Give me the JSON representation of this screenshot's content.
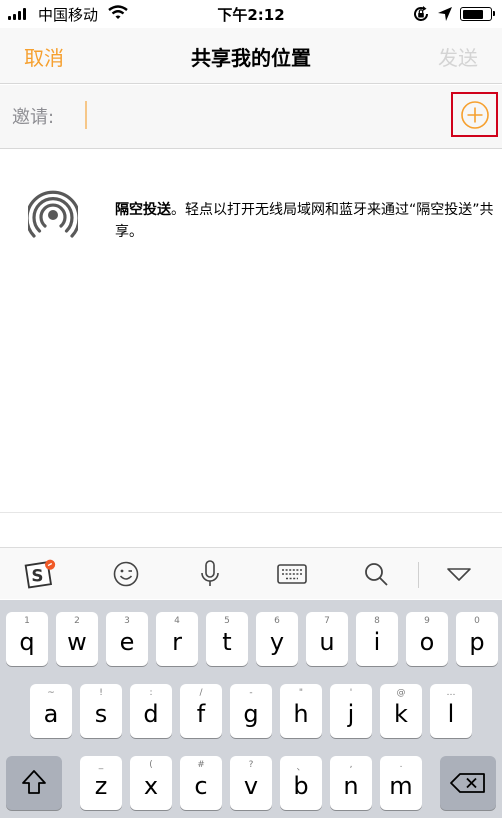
{
  "status_bar": {
    "carrier": "中国移动",
    "time": "下午2:12",
    "battery_level": 0.75
  },
  "nav": {
    "cancel_label": "取消",
    "title": "共享我的位置",
    "send_label": "发送"
  },
  "invite": {
    "label": "邀请:",
    "value": ""
  },
  "airdrop": {
    "title": "隔空投送",
    "description": "。轻点以打开无线局域网和蓝牙来通过“隔空投送”共享。"
  },
  "keyboard": {
    "row1": [
      {
        "main": "q",
        "sub": "1"
      },
      {
        "main": "w",
        "sub": "2"
      },
      {
        "main": "e",
        "sub": "3"
      },
      {
        "main": "r",
        "sub": "4"
      },
      {
        "main": "t",
        "sub": "5"
      },
      {
        "main": "y",
        "sub": "6"
      },
      {
        "main": "u",
        "sub": "7"
      },
      {
        "main": "i",
        "sub": "8"
      },
      {
        "main": "o",
        "sub": "9"
      },
      {
        "main": "p",
        "sub": "0"
      }
    ],
    "row2": [
      {
        "main": "a",
        "sub": "~"
      },
      {
        "main": "s",
        "sub": "!"
      },
      {
        "main": "d",
        "sub": ":"
      },
      {
        "main": "f",
        "sub": "/"
      },
      {
        "main": "g",
        "sub": "-"
      },
      {
        "main": "h",
        "sub": "\""
      },
      {
        "main": "j",
        "sub": "'"
      },
      {
        "main": "k",
        "sub": "@"
      },
      {
        "main": "l",
        "sub": "…"
      }
    ],
    "row3": [
      {
        "main": "z",
        "sub": "_"
      },
      {
        "main": "x",
        "sub": "("
      },
      {
        "main": "c",
        "sub": "#"
      },
      {
        "main": "v",
        "sub": "?"
      },
      {
        "main": "b",
        "sub": "、"
      },
      {
        "main": "n",
        "sub": ","
      },
      {
        "main": "m",
        "sub": "."
      }
    ]
  },
  "icons": {
    "add": "plus-circle-icon",
    "airdrop": "airdrop-icon",
    "sogou": "sogou-logo-icon",
    "emoji": "emoji-icon",
    "mic": "microphone-icon",
    "keyboard": "keyboard-icon",
    "search": "search-icon",
    "hide": "chevron-down-icon",
    "shift": "shift-icon",
    "delete": "delete-icon"
  },
  "colors": {
    "accent": "#f6a02f",
    "highlight": "#d0021b",
    "disabled": "#d4d4d4"
  }
}
